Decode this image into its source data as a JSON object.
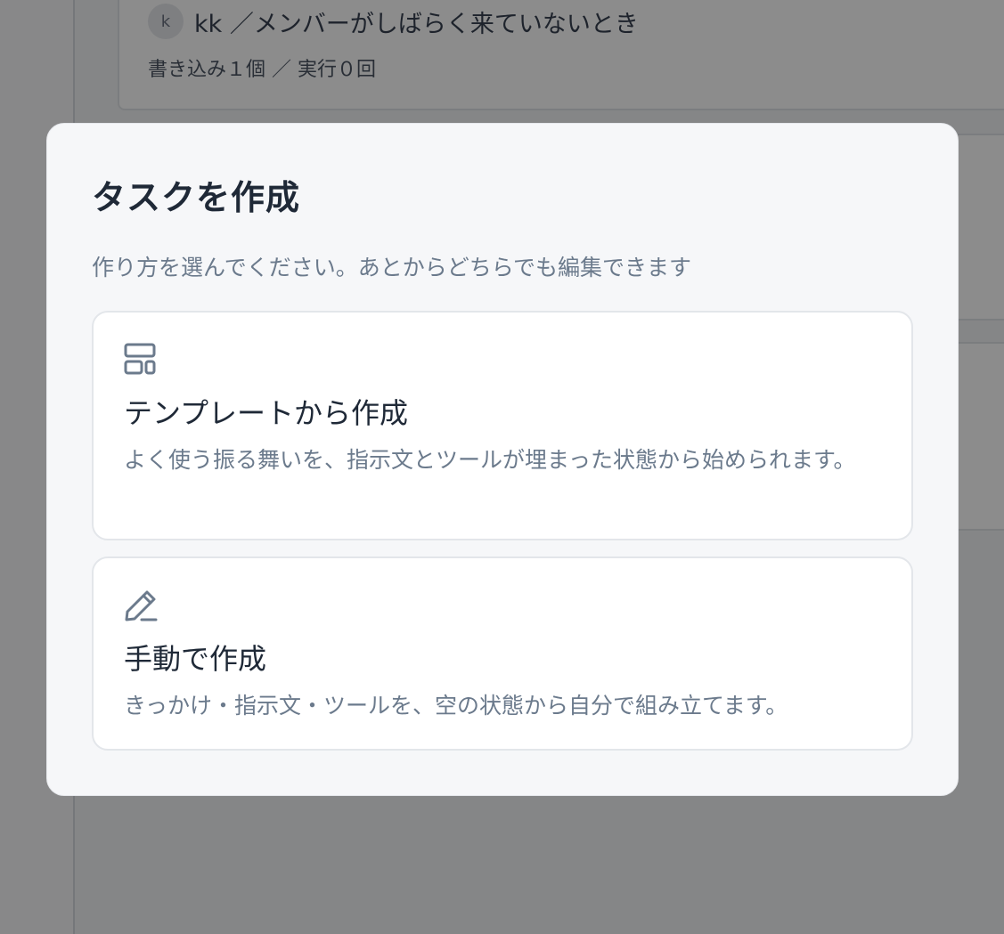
{
  "background": {
    "task": {
      "avatar_initial": "k",
      "title": "kk ／メンバーがしばらく来ていないとき",
      "meta": "書き込み１個 ／ 実行０回"
    }
  },
  "modal": {
    "title": "タスクを作成",
    "subtitle": "作り方を選んでください。あとからどちらでも編集できます",
    "options": [
      {
        "icon": "template-layout-icon",
        "title": "テンプレートから作成",
        "description": "よく使う振る舞いを、指示文とツールが埋まった状態から始められます。"
      },
      {
        "icon": "pencil-icon",
        "title": "手動で作成",
        "description": "きっかけ・指示文・ツールを、空の状態から自分で組み立てます。"
      }
    ]
  }
}
